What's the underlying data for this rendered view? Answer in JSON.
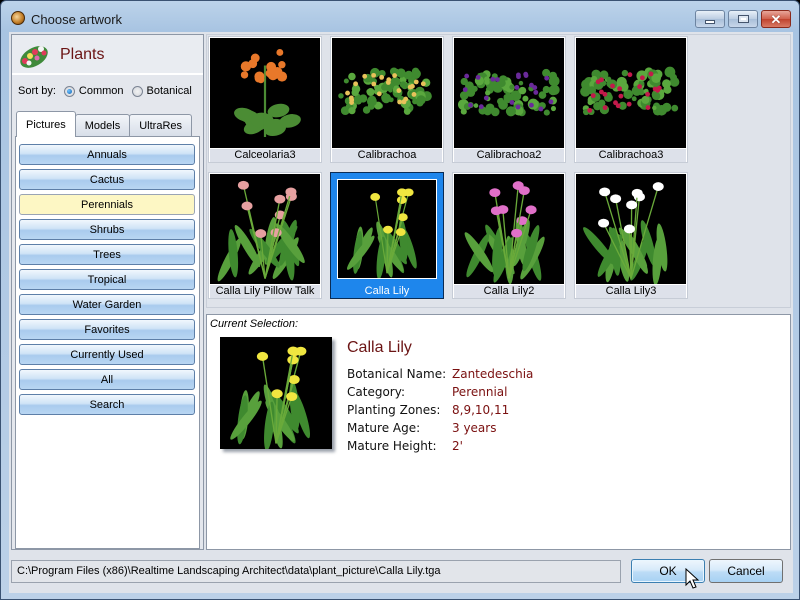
{
  "window": {
    "title": "Choose artwork",
    "controls": {
      "minimize": "minimize",
      "maximize": "maximize",
      "close": "✕"
    }
  },
  "sidebar": {
    "header": "Plants",
    "sort_by_label": "Sort by:",
    "sort_options": [
      {
        "label": "Common",
        "checked": true
      },
      {
        "label": "Botanical",
        "checked": false
      }
    ],
    "tabs": [
      {
        "label": "Pictures",
        "active": true
      },
      {
        "label": "Models",
        "active": false
      },
      {
        "label": "UltraRes",
        "active": false
      }
    ],
    "categories": [
      {
        "label": "Annuals",
        "selected": false
      },
      {
        "label": "Cactus",
        "selected": false
      },
      {
        "label": "Perennials",
        "selected": true
      },
      {
        "label": "Shrubs",
        "selected": false
      },
      {
        "label": "Trees",
        "selected": false
      },
      {
        "label": "Tropical",
        "selected": false
      },
      {
        "label": "Water Garden",
        "selected": false
      },
      {
        "label": "Favorites",
        "selected": false
      },
      {
        "label": "Currently Used",
        "selected": false
      },
      {
        "label": "All",
        "selected": false
      },
      {
        "label": "Search",
        "selected": false
      }
    ]
  },
  "thumbnails": [
    {
      "label": "Calceolaria3",
      "selected": false,
      "flower_color": "#e8782a"
    },
    {
      "label": "Calibrachoa",
      "selected": false,
      "flower_color": "#e8c25a"
    },
    {
      "label": "Calibrachoa2",
      "selected": false,
      "flower_color": "#6a2a9a"
    },
    {
      "label": "Calibrachoa3",
      "selected": false,
      "flower_color": "#c21a4a"
    },
    {
      "label": "Calla Lily Pillow Talk",
      "selected": false,
      "flower_color": "#e6a0a0"
    },
    {
      "label": "Calla Lily",
      "selected": true,
      "flower_color": "#f0e640"
    },
    {
      "label": "Calla Lily2",
      "selected": false,
      "flower_color": "#e070c8"
    },
    {
      "label": "Calla Lily3",
      "selected": false,
      "flower_color": "#ffffff"
    }
  ],
  "selection": {
    "caption": "Current Selection:",
    "name": "Calla Lily",
    "fields": [
      {
        "key": "Botanical Name:",
        "value": "Zantedeschia"
      },
      {
        "key": "Category:",
        "value": "Perennial"
      },
      {
        "key": "Planting Zones:",
        "value": "8,9,10,11"
      },
      {
        "key": "Mature Age:",
        "value": "3 years"
      },
      {
        "key": "Mature Height:",
        "value": "2'"
      }
    ]
  },
  "footer": {
    "path": "C:\\Program Files (x86)\\Realtime Landscaping Architect\\data\\plant_picture\\Calla Lily.tga",
    "ok_label": "OK",
    "cancel_label": "Cancel"
  },
  "scrollbar": {
    "up": "▲",
    "down": "▼"
  },
  "colors": {
    "accent_selected": "#1e86ec",
    "category_selected": "#fdf7c4",
    "title_red": "#6b1414",
    "value_red": "#7a1010"
  }
}
